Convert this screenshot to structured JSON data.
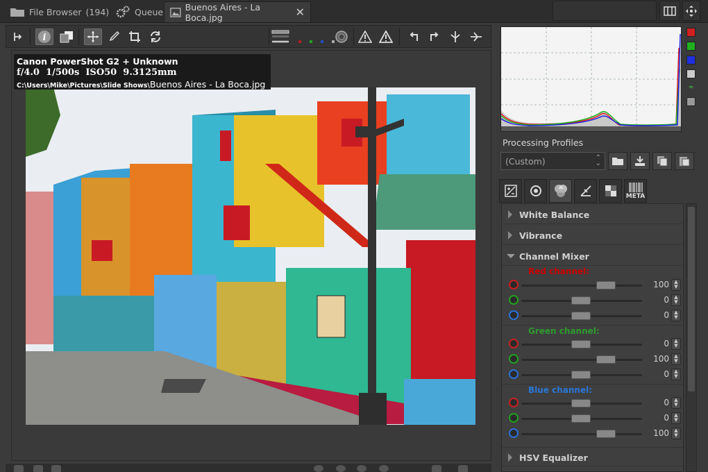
{
  "tabs": {
    "file_browser": "File Browser",
    "file_browser_count": "(194)",
    "queue": "Queue",
    "editor": "Buenos Aires - La Boca.jpg"
  },
  "info": {
    "camera": "Canon PowerShot G2 + Unknown",
    "aperture": "f/4.0",
    "shutter": "1/500s",
    "iso": "ISO50",
    "focal": "9.3125mm",
    "path_prefix": "C:\\Users\\Mike\\Pictures\\Slide Shows\\",
    "filename": "Buenos Aires - La Boca.jpg"
  },
  "processing_profiles": {
    "title": "Processing Profiles",
    "value": "(Custom)"
  },
  "tool_tabs": {
    "meta": "META"
  },
  "sections": {
    "white_balance": "White Balance",
    "vibrance": "Vibrance",
    "channel_mixer": "Channel Mixer",
    "hsv_equalizer": "HSV Equalizer"
  },
  "channel_mixer": {
    "red": {
      "title": "Red channel:",
      "values": [
        "100",
        "0",
        "0"
      ]
    },
    "green": {
      "title": "Green channel:",
      "values": [
        "0",
        "100",
        "0"
      ]
    },
    "blue": {
      "title": "Blue channel:",
      "values": [
        "0",
        "0",
        "100"
      ]
    }
  },
  "colors": {
    "red": "#cc0000",
    "green": "#2e9b2e",
    "blue": "#2a78d8",
    "accent_selected": "#5a5a5a"
  },
  "icons": [
    "folder-icon",
    "gear-icon",
    "image-icon",
    "close-icon",
    "crop-icon",
    "info-icon",
    "compare-icon",
    "hand-icon",
    "picker-icon",
    "crop-tool-icon",
    "straighten-icon",
    "warning-icon",
    "rotate-left-icon",
    "rotate-right-icon",
    "flip-icon"
  ]
}
